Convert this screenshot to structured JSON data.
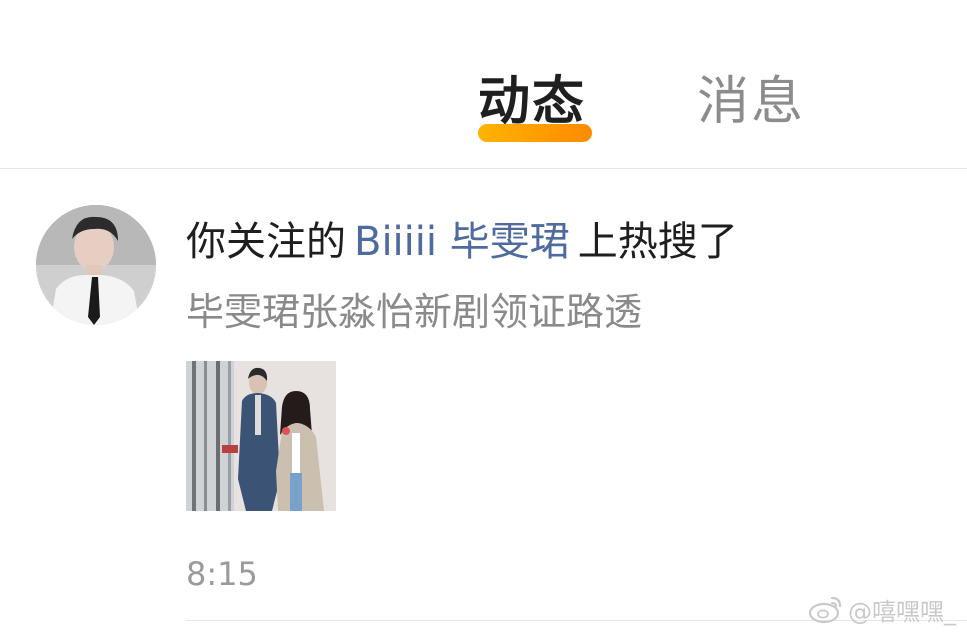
{
  "tabs": {
    "active_label": "动态",
    "inactive_label": "消息",
    "accent_color": "#ff9800"
  },
  "notification": {
    "title_prefix": "你关注的",
    "user_name": "Biiiii 毕雯珺",
    "title_suffix": "上热搜了",
    "subtitle": "毕雯珺张淼怡新剧领证路透",
    "timestamp": "8:15",
    "user_link_color": "#4e6a9e"
  },
  "watermark": {
    "text": "@嘻嘿嘿_",
    "icon": "weibo-logo-icon"
  }
}
